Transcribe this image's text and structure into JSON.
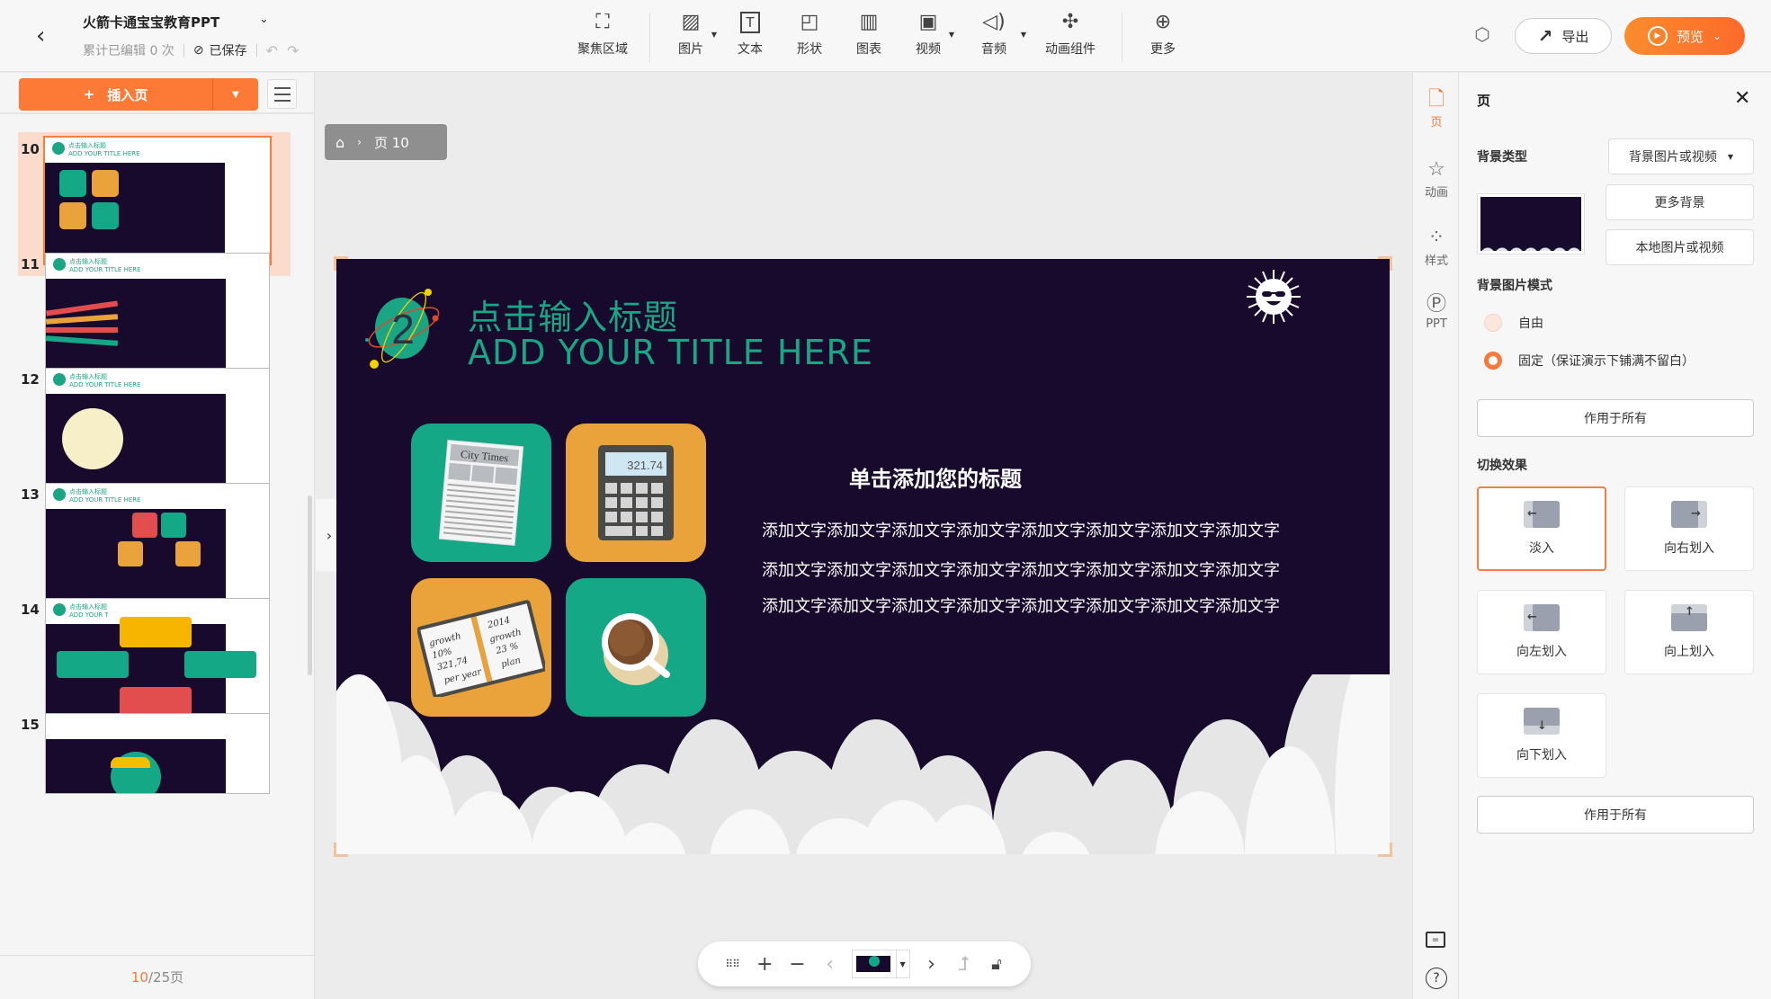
{
  "topbar": {
    "doc_title": "火箭卡通宝宝教育PPT",
    "edit_count": "累计已编辑 0 次",
    "saved": "已保存",
    "icons": {
      "back": "chevron-left-icon",
      "caret": "chevron-down-icon",
      "saved": "check-circle-icon",
      "undo": "undo-icon",
      "redo": "redo-icon"
    },
    "tools": [
      {
        "label": "聚焦区域",
        "icon": "focus-frame-icon",
        "glyph": "⛶",
        "dropdown": false
      },
      {
        "label": "图片",
        "icon": "image-icon",
        "glyph": "🖼",
        "dropdown": true
      },
      {
        "label": "文本",
        "icon": "text-icon",
        "glyph": "T",
        "dropdown": false
      },
      {
        "label": "形状",
        "icon": "shape-icon",
        "glyph": "◰",
        "dropdown": false
      },
      {
        "label": "图表",
        "icon": "chart-icon",
        "glyph": "▥",
        "dropdown": false
      },
      {
        "label": "视频",
        "icon": "video-icon",
        "glyph": "▣",
        "dropdown": true
      },
      {
        "label": "音频",
        "icon": "audio-icon",
        "glyph": "🔈",
        "dropdown": true
      },
      {
        "label": "动画组件",
        "icon": "puzzle-icon",
        "glyph": "✣",
        "dropdown": false
      },
      {
        "label": "更多",
        "icon": "plus-circle-icon",
        "glyph": "⊕",
        "dropdown": false
      }
    ],
    "export_label": "导出",
    "preview_label": "预览"
  },
  "left_panel": {
    "insert_label": "插入页",
    "thumbnails": [
      {
        "num": "10",
        "title_cn": "点击输入标题",
        "title_en": "ADD YOUR TITLE HERE",
        "active": true
      },
      {
        "num": "11",
        "title_cn": "点击输入标题",
        "title_en": "ADD YOUR TITLE HERE",
        "active": false
      },
      {
        "num": "12",
        "title_cn": "点击输入标题",
        "title_en": "ADD YOUR TITLE HERE",
        "active": false
      },
      {
        "num": "13",
        "title_cn": "点击输入标题",
        "title_en": "ADD YOUR TITLE HERE",
        "active": false
      },
      {
        "num": "14",
        "title_cn": "点击输入标题",
        "title_en": "ADD YOUR T",
        "active": false
      },
      {
        "num": "15",
        "title_cn": "",
        "title_en": "",
        "active": false
      }
    ],
    "pager": {
      "current": "10",
      "total": "/25页"
    }
  },
  "stage": {
    "breadcrumb": {
      "page": "页 10"
    },
    "slide": {
      "logo_number": "2",
      "title_cn": "点击输入标题",
      "title_en": "ADD YOUR TITLE HERE",
      "subtitle": "单击添加您的标题",
      "body_lines": [
        "添加文字添加文字添加文字添加文字添加文字添加文字添加文字添加文字",
        "添加文字添加文字添加文字添加文字添加文字添加文字添加文字添加文字",
        "添加文字添加文字添加文字添加文字添加文字添加文字添加文字添加文字"
      ],
      "tiles": {
        "newspaper": "City Times",
        "calculator": "321.74",
        "notebook_left": [
          "growth",
          "10%",
          "321,74",
          "per year"
        ],
        "notebook_right": [
          "2014",
          "growth",
          "23 %",
          "plan"
        ]
      }
    }
  },
  "right_strip": {
    "items": [
      {
        "label": "页",
        "icon": "page-icon",
        "glyph": "🗋",
        "active": true
      },
      {
        "label": "动画",
        "icon": "animation-star-icon",
        "glyph": "☆",
        "active": false
      },
      {
        "label": "样式",
        "icon": "style-grid-icon",
        "glyph": "⁘",
        "active": false
      },
      {
        "label": "PPT",
        "icon": "ppt-icon",
        "glyph": "Ⓟ",
        "active": false
      }
    ]
  },
  "right_panel": {
    "title": "页",
    "bg_type_label": "背景类型",
    "bg_type_value": "背景图片或视频",
    "more_bg": "更多背景",
    "local_media": "本地图片或视频",
    "bg_mode_label": "背景图片模式",
    "mode_options": [
      {
        "label": "自由",
        "selected": false
      },
      {
        "label": "固定（保证演示下铺满不留白）",
        "selected": true
      }
    ],
    "apply_all": "作用于所有",
    "transition_label": "切换效果",
    "transitions": [
      {
        "label": "淡入",
        "active": true
      },
      {
        "label": "向右划入",
        "active": false
      },
      {
        "label": "向左划入",
        "active": false
      },
      {
        "label": "向上划入",
        "active": false
      },
      {
        "label": "向下划入",
        "active": false
      }
    ],
    "apply_all_2": "作用于所有"
  },
  "colors": {
    "accent": "#f57a3b",
    "slide_bg": "#170a2c",
    "teal": "#14a886",
    "orange": "#eaa23a"
  }
}
